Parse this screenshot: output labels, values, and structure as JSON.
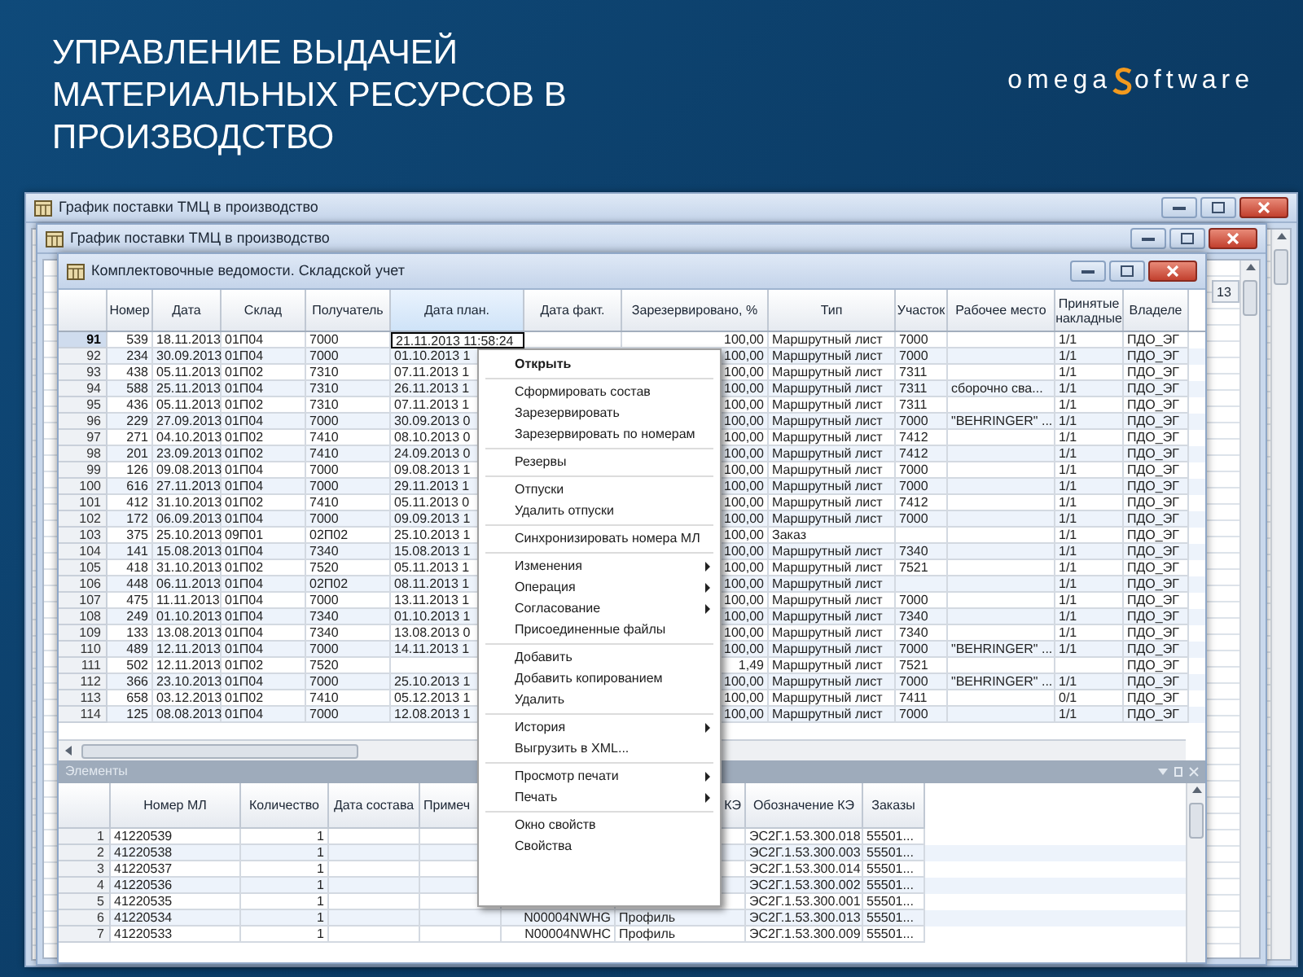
{
  "slide": {
    "title": "УПРАВЛЕНИЕ ВЫДАЧЕЙ МАТЕРИАЛЬНЫХ РЕСУРСОВ В ПРОИЗВОДСТВО",
    "logo": {
      "left": "omega",
      "right": "oftware"
    }
  },
  "back_windows": [
    {
      "title": "График поставки ТМЦ в производство"
    },
    {
      "title": "График поставки ТМЦ в производство",
      "header_cell": "13"
    }
  ],
  "window": {
    "title": "Комплектовочные ведомости. Складской учет",
    "table": {
      "columns": [
        "Номер",
        "Дата",
        "Склад",
        "Получатель",
        "Дата план.",
        "Дата факт.",
        "Зарезервировано, %",
        "Тип",
        "Участок",
        "Рабочее место",
        "Принятые накладные",
        "Владеле"
      ],
      "rows": [
        {
          "n": "91",
          "selected": true,
          "number": "539",
          "date": "18.11.2013",
          "warehouse": "01П04",
          "recipient": "7000",
          "plan_date": "21.11.2013 11:58:24",
          "reserved": "100,00",
          "type": "Маршрутный лист",
          "section": "7000",
          "accepted": "1/1",
          "owner": "ПДО_ЭГ"
        },
        {
          "n": "92",
          "selected": false,
          "number": "234",
          "date": "30.09.2013",
          "warehouse": "01П04",
          "recipient": "7000",
          "plan_date": "01.10.2013 1",
          "reserved": "100,00",
          "type": "Маршрутный лист",
          "section": "7000",
          "accepted": "1/1",
          "owner": "ПДО_ЭГ"
        },
        {
          "n": "93",
          "selected": false,
          "number": "438",
          "date": "05.11.2013",
          "warehouse": "01П02",
          "recipient": "7310",
          "plan_date": "07.11.2013 1",
          "reserved": "100,00",
          "type": "Маршрутный лист",
          "section": "7311",
          "accepted": "1/1",
          "owner": "ПДО_ЭГ"
        },
        {
          "n": "94",
          "selected": false,
          "number": "588",
          "date": "25.11.2013",
          "warehouse": "01П04",
          "recipient": "7310",
          "plan_date": "26.11.2013 1",
          "reserved": "100,00",
          "type": "Маршрутный лист",
          "section": "7311",
          "workplace": "сборочно сва...",
          "accepted": "1/1",
          "owner": "ПДО_ЭГ"
        },
        {
          "n": "95",
          "selected": false,
          "number": "436",
          "date": "05.11.2013",
          "warehouse": "01П02",
          "recipient": "7310",
          "plan_date": "07.11.2013 1",
          "reserved": "100,00",
          "type": "Маршрутный лист",
          "section": "7311",
          "accepted": "1/1",
          "owner": "ПДО_ЭГ"
        },
        {
          "n": "96",
          "selected": false,
          "number": "229",
          "date": "27.09.2013",
          "warehouse": "01П04",
          "recipient": "7000",
          "plan_date": "30.09.2013 0",
          "reserved": "100,00",
          "type": "Маршрутный лист",
          "section": "7000",
          "workplace": "\"BEHRINGER\" ...",
          "accepted": "1/1",
          "owner": "ПДО_ЭГ"
        },
        {
          "n": "97",
          "selected": false,
          "number": "271",
          "date": "04.10.2013",
          "warehouse": "01П02",
          "recipient": "7410",
          "plan_date": "08.10.2013 0",
          "reserved": "100,00",
          "type": "Маршрутный лист",
          "section": "7412",
          "accepted": "1/1",
          "owner": "ПДО_ЭГ"
        },
        {
          "n": "98",
          "selected": false,
          "number": "201",
          "date": "23.09.2013",
          "warehouse": "01П02",
          "recipient": "7410",
          "plan_date": "24.09.2013 0",
          "reserved": "100,00",
          "type": "Маршрутный лист",
          "section": "7412",
          "accepted": "1/1",
          "owner": "ПДО_ЭГ"
        },
        {
          "n": "99",
          "selected": false,
          "number": "126",
          "date": "09.08.2013",
          "warehouse": "01П04",
          "recipient": "7000",
          "plan_date": "09.08.2013 1",
          "reserved": "100,00",
          "type": "Маршрутный лист",
          "section": "7000",
          "accepted": "1/1",
          "owner": "ПДО_ЭГ"
        },
        {
          "n": "100",
          "selected": false,
          "number": "616",
          "date": "27.11.2013",
          "warehouse": "01П04",
          "recipient": "7000",
          "plan_date": "29.11.2013 1",
          "reserved": "100,00",
          "type": "Маршрутный лист",
          "section": "7000",
          "accepted": "1/1",
          "owner": "ПДО_ЭГ"
        },
        {
          "n": "101",
          "selected": false,
          "number": "412",
          "date": "31.10.2013",
          "warehouse": "01П02",
          "recipient": "7410",
          "plan_date": "05.11.2013 0",
          "reserved": "100,00",
          "type": "Маршрутный лист",
          "section": "7412",
          "accepted": "1/1",
          "owner": "ПДО_ЭГ"
        },
        {
          "n": "102",
          "selected": false,
          "number": "172",
          "date": "06.09.2013",
          "warehouse": "01П04",
          "recipient": "7000",
          "plan_date": "09.09.2013 1",
          "reserved": "100,00",
          "type": "Маршрутный лист",
          "section": "7000",
          "accepted": "1/1",
          "owner": "ПДО_ЭГ"
        },
        {
          "n": "103",
          "selected": false,
          "number": "375",
          "date": "25.10.2013",
          "warehouse": "09П01",
          "recipient": "02П02",
          "plan_date": "25.10.2013 1",
          "reserved": "100,00",
          "type": "Заказ",
          "accepted": "1/1",
          "owner": "ПДО_ЭГ"
        },
        {
          "n": "104",
          "selected": false,
          "number": "141",
          "date": "15.08.2013",
          "warehouse": "01П04",
          "recipient": "7340",
          "plan_date": "15.08.2013 1",
          "reserved": "100,00",
          "type": "Маршрутный лист",
          "section": "7340",
          "accepted": "1/1",
          "owner": "ПДО_ЭГ"
        },
        {
          "n": "105",
          "selected": false,
          "number": "418",
          "date": "31.10.2013",
          "warehouse": "01П02",
          "recipient": "7520",
          "plan_date": "05.11.2013 1",
          "reserved": "100,00",
          "type": "Маршрутный лист",
          "section": "7521",
          "accepted": "1/1",
          "owner": "ПДО_ЭГ"
        },
        {
          "n": "106",
          "selected": false,
          "number": "448",
          "date": "06.11.2013",
          "warehouse": "01П04",
          "recipient": "02П02",
          "plan_date": "08.11.2013 1",
          "reserved": "100,00",
          "type": "Маршрутный лист",
          "accepted": "1/1",
          "owner": "ПДО_ЭГ"
        },
        {
          "n": "107",
          "selected": false,
          "number": "475",
          "date": "11.11.2013",
          "warehouse": "01П04",
          "recipient": "7000",
          "plan_date": "13.11.2013 1",
          "reserved": "100,00",
          "type": "Маршрутный лист",
          "section": "7000",
          "accepted": "1/1",
          "owner": "ПДО_ЭГ"
        },
        {
          "n": "108",
          "selected": false,
          "number": "249",
          "date": "01.10.2013",
          "warehouse": "01П04",
          "recipient": "7340",
          "plan_date": "01.10.2013 1",
          "reserved": "100,00",
          "type": "Маршрутный лист",
          "section": "7340",
          "accepted": "1/1",
          "owner": "ПДО_ЭГ"
        },
        {
          "n": "109",
          "selected": false,
          "number": "133",
          "date": "13.08.2013",
          "warehouse": "01П04",
          "recipient": "7340",
          "plan_date": "13.08.2013 0",
          "reserved": "100,00",
          "type": "Маршрутный лист",
          "section": "7340",
          "accepted": "1/1",
          "owner": "ПДО_ЭГ"
        },
        {
          "n": "110",
          "selected": false,
          "number": "489",
          "date": "12.11.2013",
          "warehouse": "01П04",
          "recipient": "7000",
          "plan_date": "14.11.2013 1",
          "reserved": "100,00",
          "type": "Маршрутный лист",
          "section": "7000",
          "workplace": "\"BEHRINGER\" ...",
          "accepted": "1/1",
          "owner": "ПДО_ЭГ"
        },
        {
          "n": "111",
          "selected": false,
          "number": "502",
          "date": "12.11.2013",
          "warehouse": "01П02",
          "recipient": "7520",
          "reserved": "1,49",
          "type": "Маршрутный лист",
          "section": "7521",
          "owner": "ПДО_ЭГ"
        },
        {
          "n": "112",
          "selected": false,
          "number": "366",
          "date": "23.10.2013",
          "warehouse": "01П04",
          "recipient": "7000",
          "plan_date": "25.10.2013 1",
          "reserved": "100,00",
          "type": "Маршрутный лист",
          "section": "7000",
          "workplace": "\"BEHRINGER\" ...",
          "accepted": "1/1",
          "owner": "ПДО_ЭГ"
        },
        {
          "n": "113",
          "selected": false,
          "number": "658",
          "date": "03.12.2013",
          "warehouse": "01П02",
          "recipient": "7410",
          "plan_date": "05.12.2013 1",
          "reserved": "100,00",
          "type": "Маршрутный лист",
          "section": "7411",
          "accepted": "0/1",
          "owner": "ПДО_ЭГ"
        },
        {
          "n": "114",
          "selected": false,
          "number": "125",
          "date": "08.08.2013",
          "warehouse": "01П04",
          "recipient": "7000",
          "plan_date": "12.08.2013 1",
          "reserved": "100,00",
          "type": "Маршрутный лист",
          "section": "7000",
          "accepted": "1/1",
          "owner": "ПДО_ЭГ"
        }
      ]
    },
    "elements_panel": {
      "title": "Элементы",
      "columns": [
        "Номер МЛ",
        "Количество",
        "Дата состава",
        "Примеч",
        "КЭ",
        "Обозначение КЭ",
        "Заказы"
      ],
      "rows": [
        {
          "n": "1",
          "ml_number": "41220539",
          "quantity": "1",
          "kd_designation": "ЭС2Г.1.53.300.018",
          "orders": "55501..."
        },
        {
          "n": "2",
          "ml_number": "41220538",
          "quantity": "1",
          "kd_designation": "ЭС2Г.1.53.300.003",
          "orders": "55501..."
        },
        {
          "n": "3",
          "ml_number": "41220537",
          "quantity": "1",
          "kd_designation": "ЭС2Г.1.53.300.014",
          "orders": "55501..."
        },
        {
          "n": "4",
          "ml_number": "41220536",
          "quantity": "1",
          "kd_designation": "ЭС2Г.1.53.300.002",
          "orders": "55501..."
        },
        {
          "n": "5",
          "ml_number": "41220535",
          "quantity": "1",
          "kd_designation": "ЭС2Г.1.53.300.001",
          "orders": "55501..."
        },
        {
          "n": "6",
          "ml_number": "41220534",
          "quantity": "1",
          "column_6": "N00004NWHG",
          "column_7": "Профиль",
          "kd_designation": "ЭС2Г.1.53.300.013",
          "orders": "55501..."
        },
        {
          "n": "7",
          "ml_number": "41220533",
          "quantity": "1",
          "column_6": "N00004NWHC",
          "column_7": "Профиль",
          "kd_designation": "ЭС2Г.1.53.300.009",
          "orders": "55501..."
        }
      ]
    },
    "context_menu": {
      "groups": [
        [
          {
            "label": "Открыть",
            "default": true,
            "submenu": false
          }
        ],
        [
          {
            "label": "Сформировать состав",
            "default": false,
            "submenu": false
          },
          {
            "label": "Зарезервировать",
            "default": false,
            "submenu": false
          },
          {
            "label": "Зарезервировать по номерам",
            "default": false,
            "submenu": false
          }
        ],
        [
          {
            "label": "Резервы",
            "default": false,
            "submenu": false
          }
        ],
        [
          {
            "label": "Отпуски",
            "default": false,
            "submenu": false
          },
          {
            "label": "Удалить отпуски",
            "default": false,
            "submenu": false
          }
        ],
        [
          {
            "label": "Синхронизировать номера МЛ",
            "default": false,
            "submenu": false
          }
        ],
        [
          {
            "label": "Изменения",
            "default": false,
            "submenu": true
          },
          {
            "label": "Операция",
            "default": false,
            "submenu": true
          },
          {
            "label": "Согласование",
            "default": false,
            "submenu": true
          },
          {
            "label": "Присоединенные файлы",
            "default": false,
            "submenu": false
          }
        ],
        [
          {
            "label": "Добавить",
            "default": false,
            "submenu": false
          },
          {
            "label": "Добавить копированием",
            "default": false,
            "submenu": false
          },
          {
            "label": "Удалить",
            "default": false,
            "submenu": false
          }
        ],
        [
          {
            "label": "История",
            "default": false,
            "submenu": true
          },
          {
            "label": "Выгрузить в XML...",
            "default": false,
            "submenu": false
          }
        ],
        [
          {
            "label": "Просмотр печати",
            "default": false,
            "submenu": true
          },
          {
            "label": "Печать",
            "default": false,
            "submenu": true
          }
        ],
        [
          {
            "label": "Окно свойств",
            "default": false,
            "submenu": false
          },
          {
            "label": "Свойства",
            "default": false,
            "submenu": false
          }
        ]
      ]
    }
  }
}
